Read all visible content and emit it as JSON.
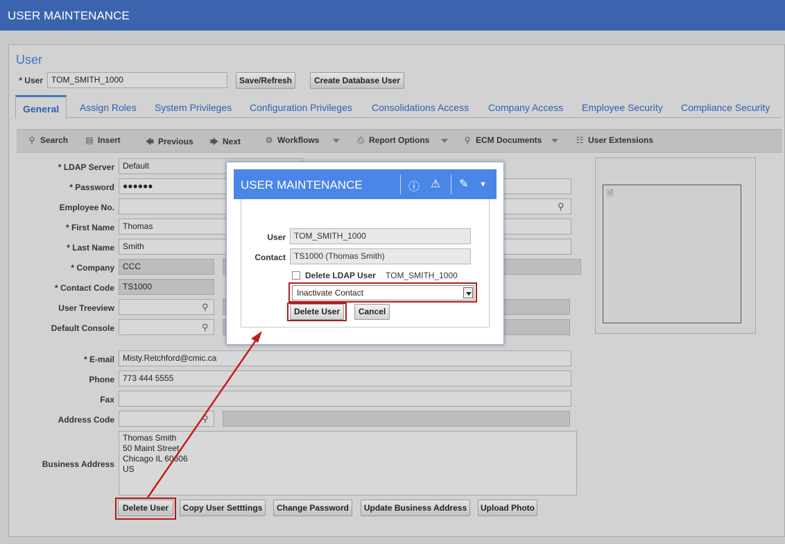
{
  "app": {
    "title": "USER MAINTENANCE"
  },
  "section": {
    "title": "User"
  },
  "header": {
    "user_label": "* User",
    "user_value": "TOM_SMITH_1000",
    "save_refresh": "Save/Refresh",
    "create_db_user": "Create Database User"
  },
  "tabs": [
    {
      "label": "General",
      "active": true
    },
    {
      "label": "Assign Roles"
    },
    {
      "label": "System Privileges"
    },
    {
      "label": "Configuration Privileges"
    },
    {
      "label": "Consolidations Access"
    },
    {
      "label": "Company Access"
    },
    {
      "label": "Employee Security"
    },
    {
      "label": "Compliance Security"
    }
  ],
  "toolbar": [
    {
      "label": "Search",
      "icon": "search-icon"
    },
    {
      "label": "Insert",
      "icon": "insert-icon"
    },
    {
      "label": "Previous",
      "icon": "arrow-left-icon"
    },
    {
      "label": "Next",
      "icon": "arrow-right-icon"
    },
    {
      "label": "Workflows",
      "icon": "gears-icon"
    },
    {
      "label": "Report Options",
      "icon": "printer-icon"
    },
    {
      "label": "ECM Documents",
      "icon": "ecm-icon"
    },
    {
      "label": "User Extensions",
      "icon": "hierarchy-icon"
    }
  ],
  "form": {
    "ldap_server": {
      "label": "* LDAP Server",
      "value": "Default"
    },
    "password": {
      "label": "* Password",
      "value": "●●●●●●"
    },
    "employee_no": {
      "label": "Employee No.",
      "value": ""
    },
    "first_name": {
      "label": "* First Name",
      "value": "Thomas"
    },
    "last_name": {
      "label": "* Last Name",
      "value": "Smith"
    },
    "company": {
      "label": "* Company",
      "value": "CCC"
    },
    "contact_code": {
      "label": "* Contact Code",
      "value": "TS1000"
    },
    "user_treeview": {
      "label": "User Treeview",
      "value": ""
    },
    "default_console": {
      "label": "Default Console",
      "value": ""
    },
    "email": {
      "label": "* E-mail",
      "value": "Misty.Retchford@cmic.ca"
    },
    "phone": {
      "label": "Phone",
      "value": "773 444 5555"
    },
    "fax": {
      "label": "Fax",
      "value": ""
    },
    "address_code": {
      "label": "Address Code",
      "value": ""
    },
    "business_address": {
      "label": "Business Address",
      "lines": [
        "Thomas Smith",
        "50 Maint Street",
        "Chicago IL 60606",
        "US"
      ]
    }
  },
  "bottom_buttons": {
    "delete_user": "Delete User",
    "copy_settings": "Copy User Setttings",
    "change_password": "Change Password",
    "update_address": "Update Business Address",
    "upload_photo": "Upload Photo"
  },
  "dialog": {
    "title": "USER MAINTENANCE",
    "user_label": "User",
    "user_value": "TOM_SMITH_1000",
    "contact_label": "Contact",
    "contact_value": "TS1000 (Thomas Smith)",
    "delete_ldap_label": "Delete LDAP User",
    "delete_ldap_value": "TOM_SMITH_1000",
    "delete_ldap_checked": false,
    "select_value": "Inactivate Contact",
    "delete_button": "Delete User",
    "cancel_button": "Cancel"
  },
  "colors": {
    "header_blue": "#3a64ad",
    "dialog_blue": "#4a86e8",
    "highlight_red": "#b21a1a",
    "tab_text": "#2f5fb0"
  }
}
